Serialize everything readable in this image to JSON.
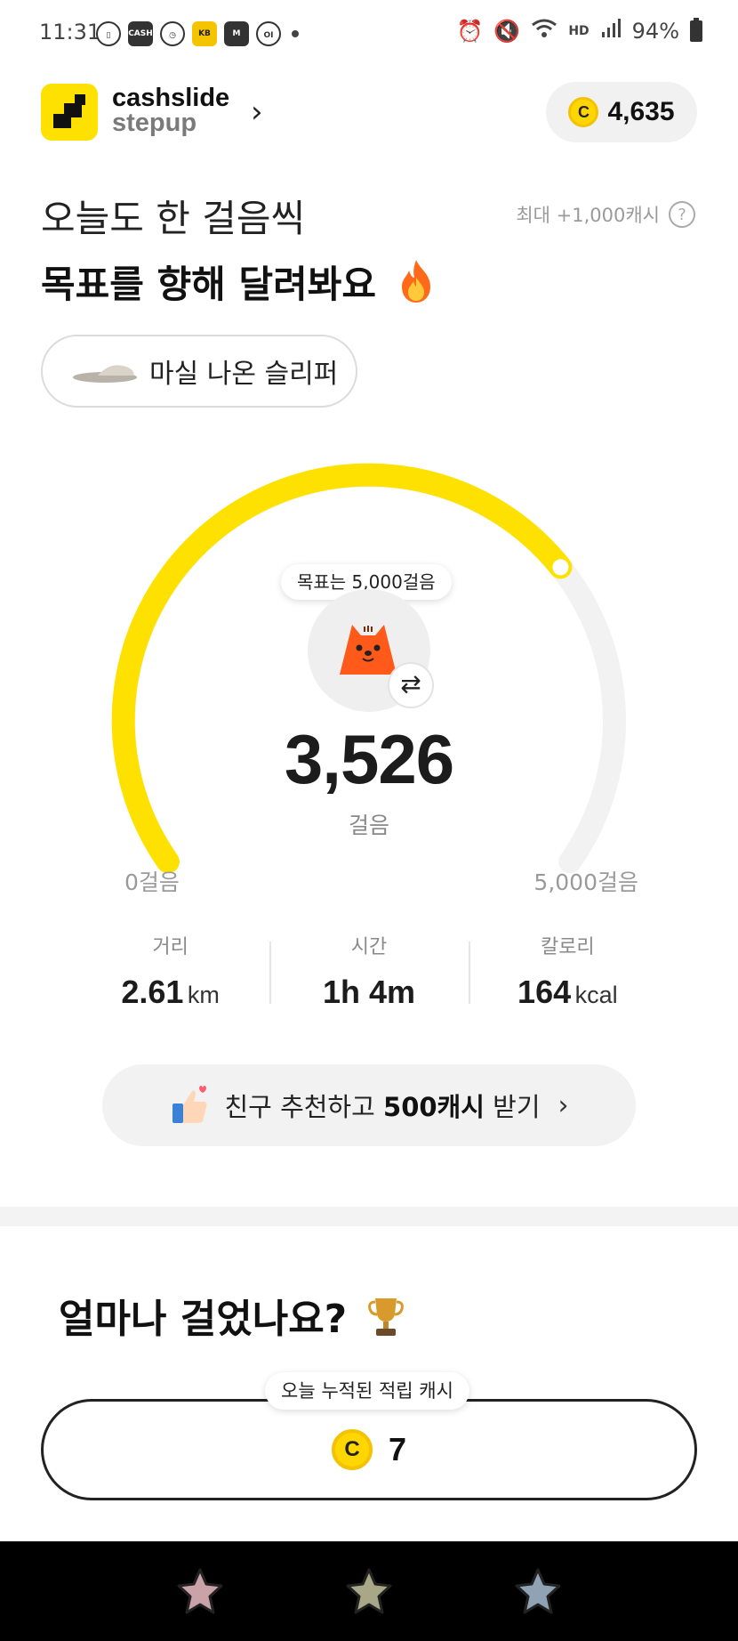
{
  "status_bar": {
    "time": "11:31",
    "left_icons": [
      "phone-icon",
      "cash-icon",
      "clock-icon",
      "kb-icon",
      "m-icon",
      "lock-icon"
    ],
    "hd_label": "HD",
    "battery": "94%"
  },
  "header": {
    "brand_line1": "cashslide",
    "brand_line2": "stepup",
    "chevron": "›",
    "coin_symbol": "C",
    "cash_balance": "4,635"
  },
  "hero": {
    "title_line1": "오늘도 한 걸음씩",
    "title_line2": "목표를 향해 달려봐요",
    "max_reward": "최대 +1,000캐시",
    "help": "?"
  },
  "item": {
    "label": "마실 나온 슬리퍼"
  },
  "gauge": {
    "goal_tooltip": "목표는 5,000걸음",
    "steps": "3,526",
    "steps_unit": "걸음",
    "min_label": "0걸음",
    "max_label": "5,000걸음",
    "progress": 0.7052,
    "swap": "⇄",
    "colors": {
      "track": "#f2f2f2",
      "fill": "#ffe100"
    }
  },
  "stats": [
    {
      "label": "거리",
      "value": "2.61",
      "unit": "km"
    },
    {
      "label": "시간",
      "value": "1h 4m",
      "unit": ""
    },
    {
      "label": "칼로리",
      "value": "164",
      "unit": "kcal"
    }
  ],
  "referral": {
    "text_pre": "친구 추천하고 ",
    "text_bold": "500캐시",
    "text_post": " 받기",
    "chevron": "›"
  },
  "section": {
    "title": "얼마나 걸었나요?",
    "tooltip": "오늘 누적된 적립 캐시",
    "coin_symbol": "C",
    "accumulated": "7"
  },
  "bottom_nav": {
    "items": [
      "star-pink",
      "star-olive",
      "star-blue"
    ],
    "colors": [
      "#c9a3a8",
      "#a8a889",
      "#8fa3b4"
    ]
  }
}
